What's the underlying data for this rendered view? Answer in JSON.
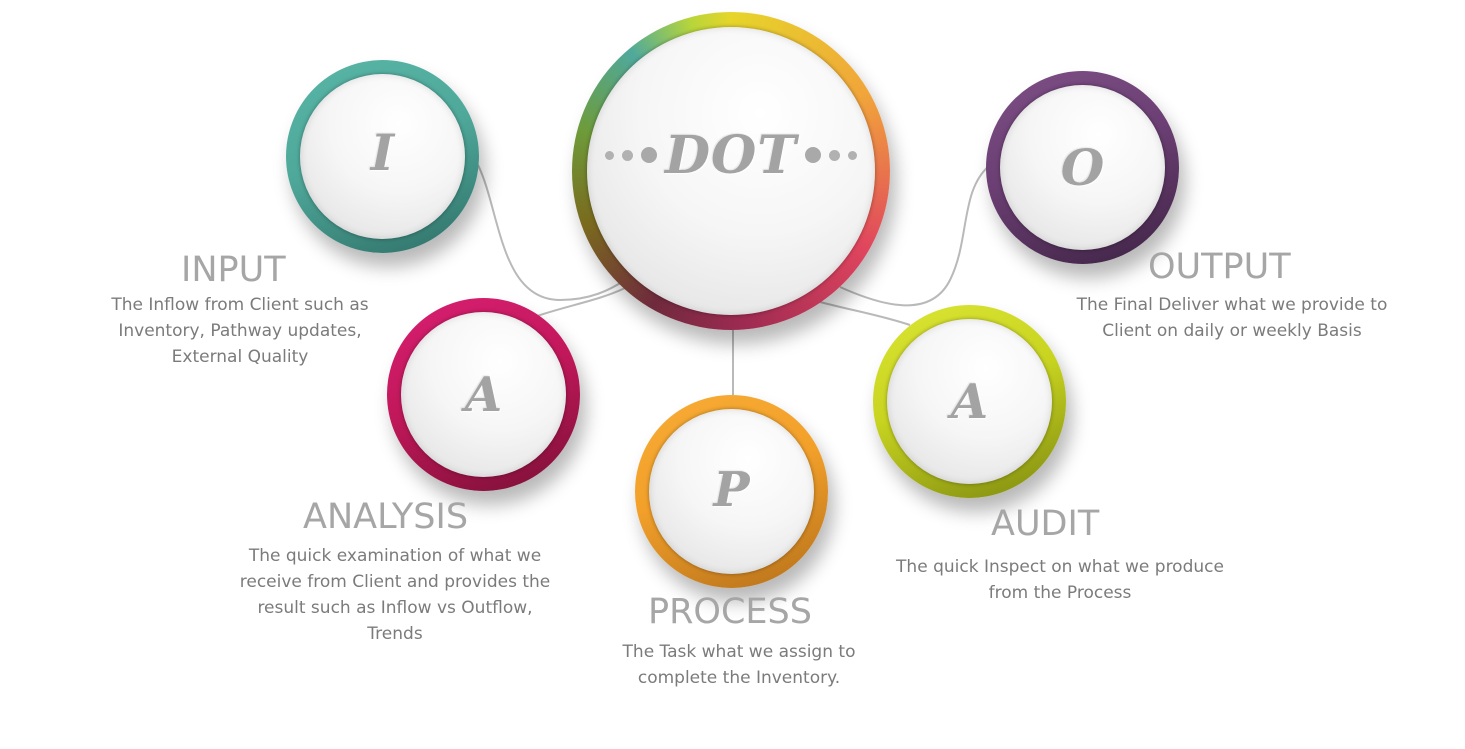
{
  "center": {
    "label": "DOT"
  },
  "nodes": {
    "input": {
      "letter": "I",
      "title": "INPUT",
      "desc_lines": [
        "The Inflow from Client such as",
        "Inventory, Pathway updates,",
        "External Quality"
      ]
    },
    "analysis": {
      "letter": "A",
      "title": "ANALYSIS",
      "desc_lines": [
        "The quick examination of what we",
        "receive from Client and provides the",
        "result such as Inflow vs Outflow,",
        "Trends"
      ]
    },
    "process": {
      "letter": "P",
      "title": "PROCESS",
      "desc_lines": [
        "The Task what we assign to",
        "complete the Inventory."
      ]
    },
    "audit": {
      "letter": "A",
      "title": "AUDIT",
      "desc_lines": [
        "The quick Inspect on what we produce",
        "from the Process"
      ]
    },
    "output": {
      "letter": "O",
      "title": "OUTPUT",
      "desc_lines": [
        "The Final Deliver what we provide to",
        "Client on daily or weekly Basis"
      ]
    }
  },
  "colors": {
    "input_ring": "#4fa99b",
    "analysis_ring": "#c2185b",
    "process_ring": "#f2a02a",
    "audit_ring": "#c8d420",
    "output_ring": "#6b3f73",
    "title_text": "#a6a6a6",
    "desc_text": "#7b7b7b",
    "letter_text": "#a3a3a3"
  }
}
